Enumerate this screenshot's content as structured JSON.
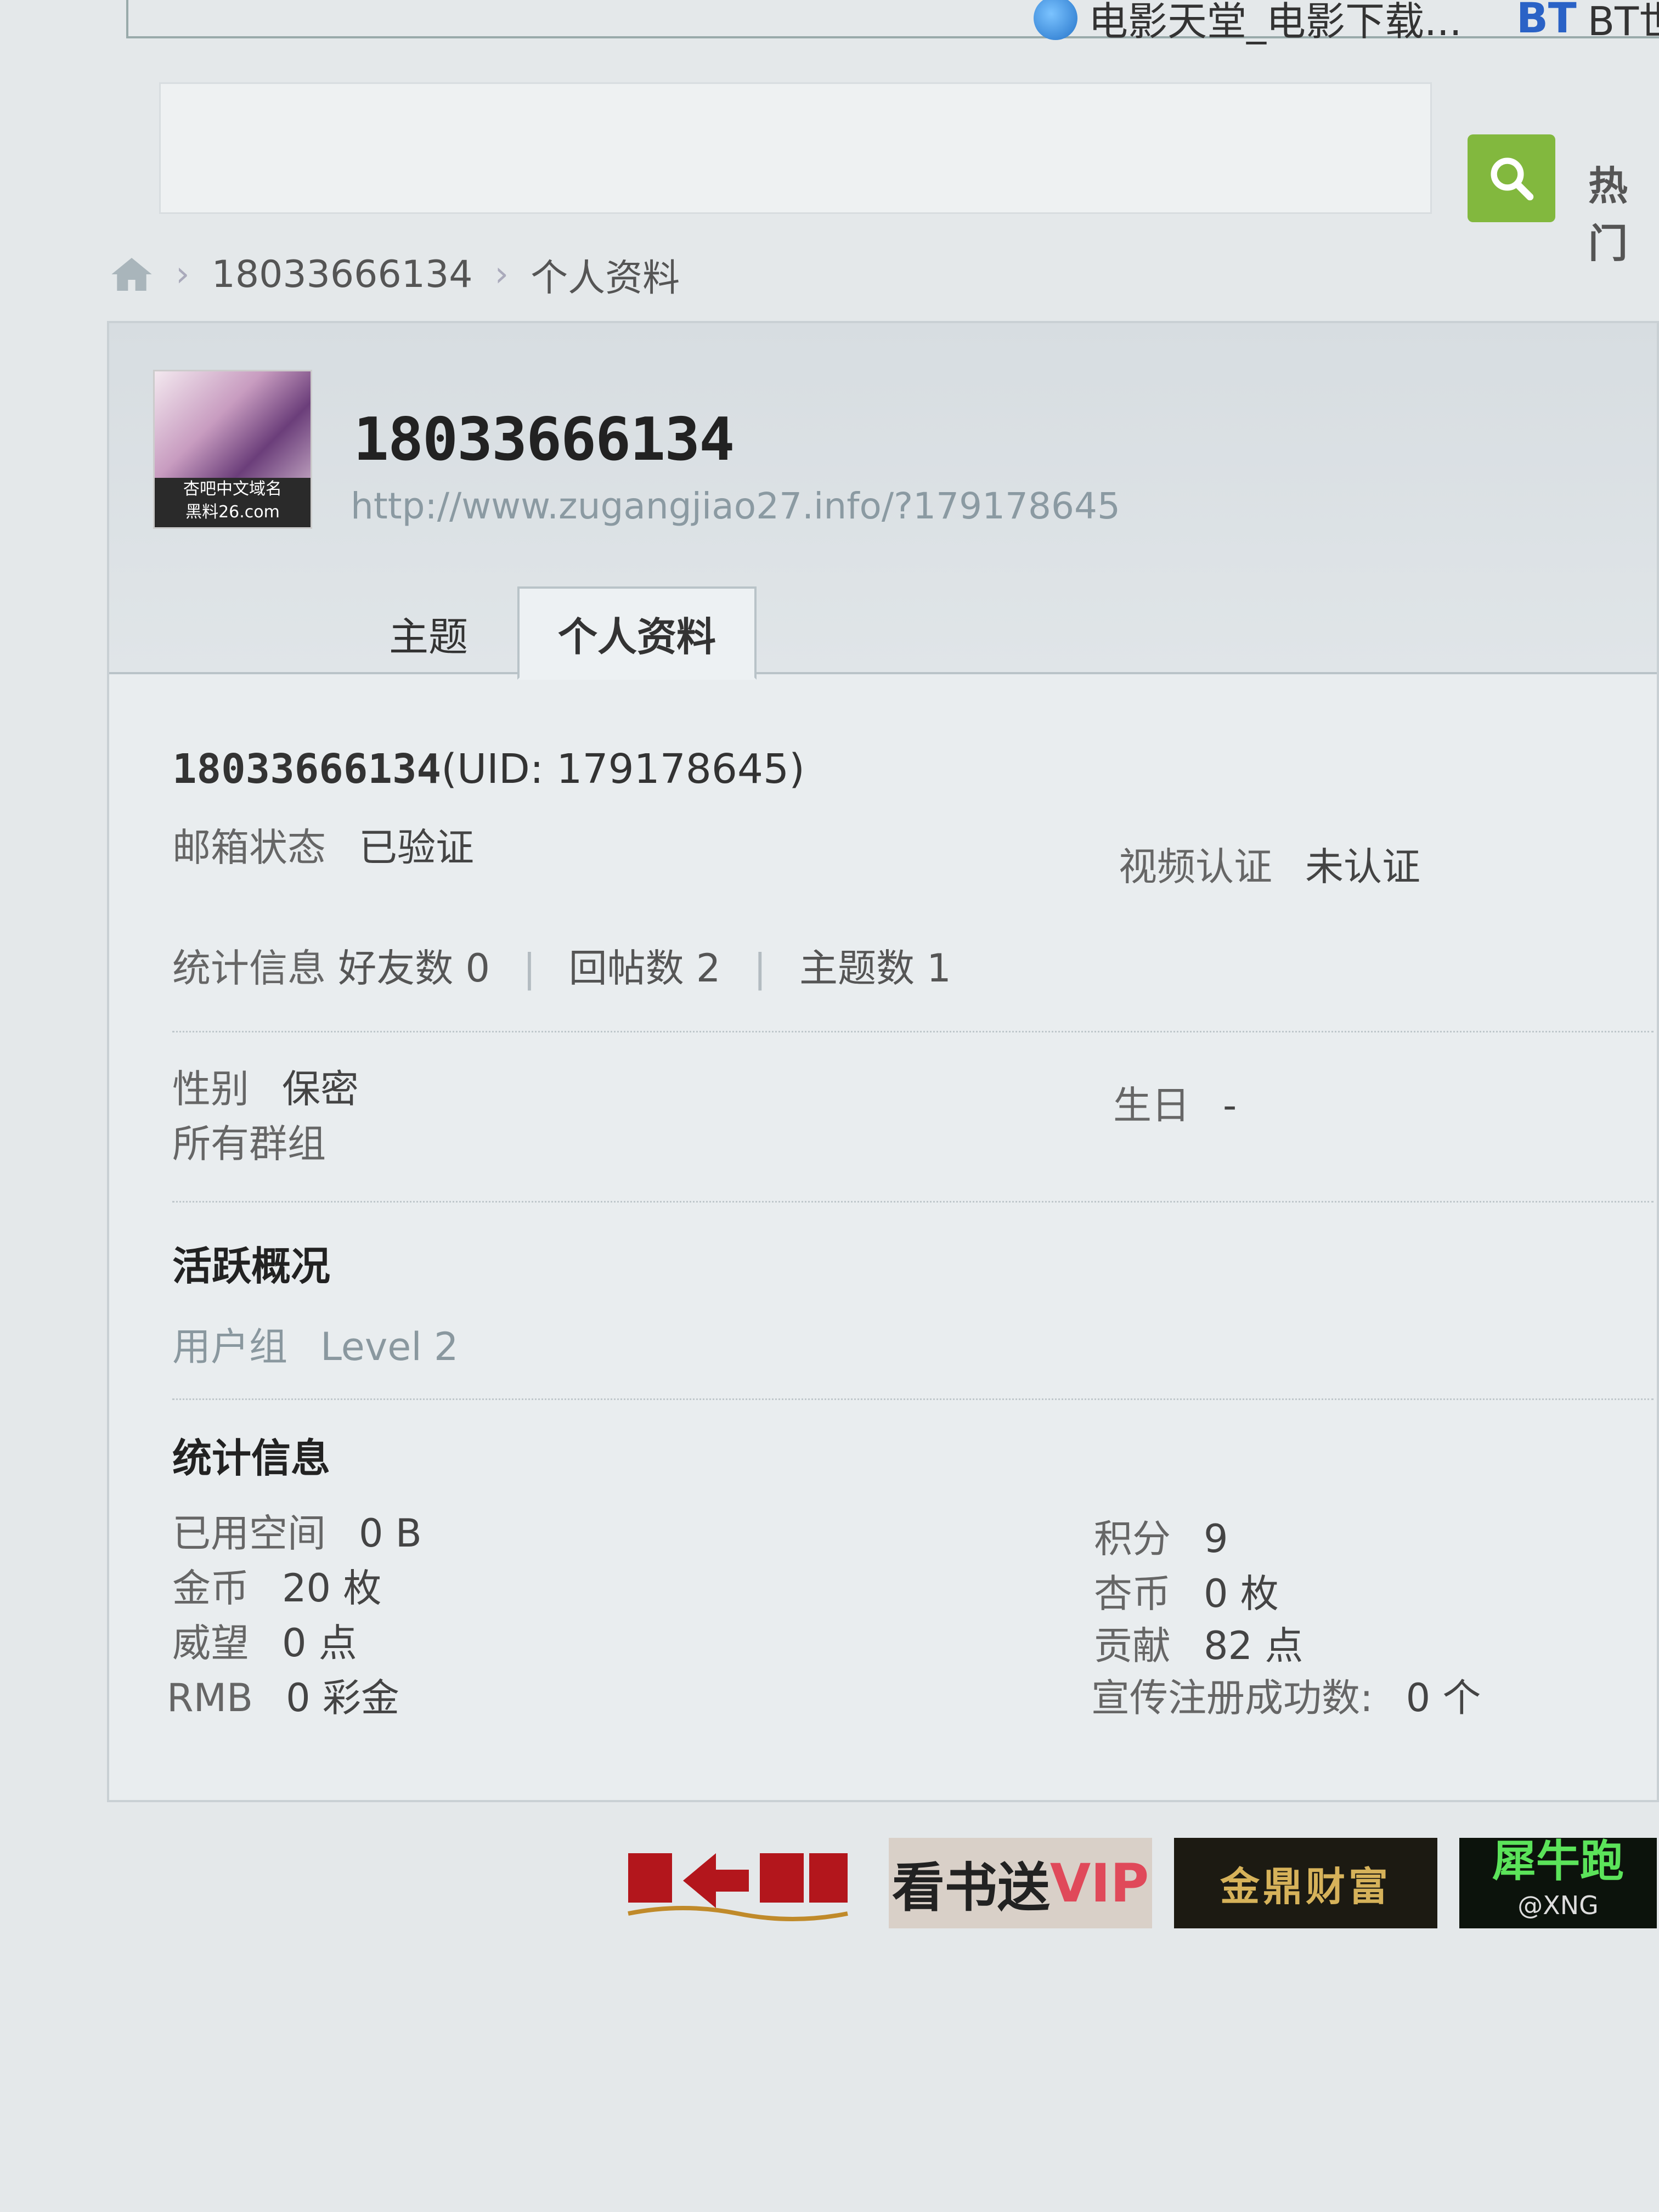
{
  "bookmarks": [
    {
      "label": "电影天堂_电影下载...",
      "icon": "globe-icon"
    },
    {
      "label": "BT世",
      "icon_text": "BT"
    }
  ],
  "search": {
    "button_icon": "search-icon",
    "hot_label": "热门"
  },
  "breadcrumb": {
    "home_icon": "home-icon",
    "user": "18033666134",
    "current": "个人资料"
  },
  "profile": {
    "avatar_caption_line1": "杏吧中文域名",
    "avatar_caption_line2": "黑料26.com",
    "username": "18033666134",
    "url": "http://www.zugangjiao27.info/?179178645",
    "tabs": [
      {
        "label": "主题"
      },
      {
        "label": "个人资料",
        "active": true
      }
    ]
  },
  "info": {
    "uid_username": "18033666134",
    "uid_text": "(UID: 179178645)",
    "email_label": "邮箱状态",
    "email_value": "已验证",
    "video_label": "视频认证",
    "video_value": "未认证",
    "stats_label": "统计信息",
    "friends": "好友数 0",
    "replies": "回帖数 2",
    "threads": "主题数 1",
    "gender_label": "性别",
    "gender_value": "保密",
    "birthday_label": "生日",
    "birthday_value": "-",
    "groups_label": "所有群组"
  },
  "activity": {
    "title": "活跃概况",
    "group_label": "用户组",
    "group_value": "Level 2"
  },
  "statistics": {
    "title": "统计信息",
    "used_space_label": "已用空间",
    "used_space_value": "0 B",
    "gold_label": "金币",
    "gold_value": "20 枚",
    "prestige_label": "威望",
    "prestige_value": "0 点",
    "rmb_label": "RMB",
    "rmb_value": "0 彩金",
    "points_label": "积分",
    "points_value": "9",
    "apricot_label": "杏币",
    "apricot_value": "0 枚",
    "contribution_label": "贡献",
    "contribution_value": "82 点",
    "referral_label": "宣传注册成功数:",
    "referral_value": "0 个"
  },
  "ads": {
    "ad2_text": "看书送",
    "ad2_vip": "VIP",
    "ad3_text": "金鼎财富",
    "ad4_text": "犀牛跑",
    "ad4_sub": "@XNG"
  }
}
